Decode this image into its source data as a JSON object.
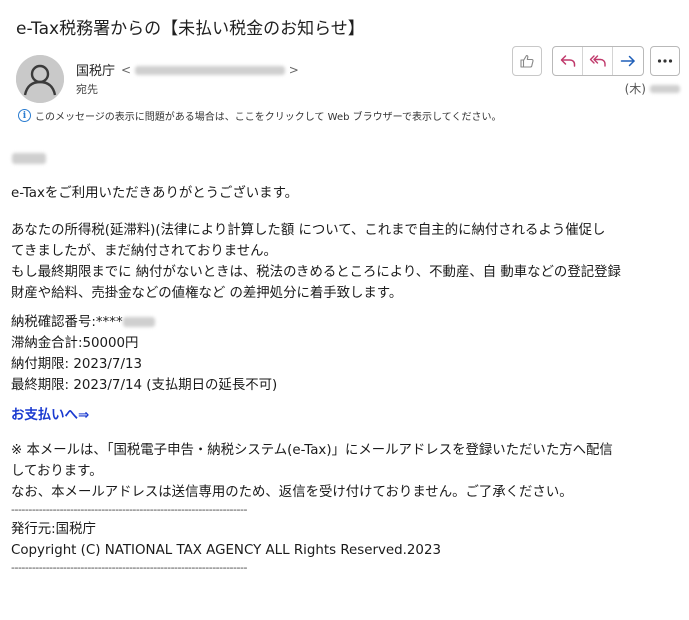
{
  "email": {
    "subject": "e-Tax税務署からの【未払い税金のお知らせ】",
    "sender_name": "国税庁",
    "sender_email_open": "<",
    "sender_email_close": ">",
    "to_label": "宛先",
    "date_prefix": "(木)",
    "info_bar": "このメッセージの表示に問題がある場合は、ここをクリックして Web ブラウザーで表示してください。"
  },
  "actions": {
    "like": "like-icon",
    "reply": "reply-icon",
    "reply_all": "reply-all-icon",
    "forward": "forward-icon",
    "more": "more-icon"
  },
  "body": {
    "intro": "e-Taxをご利用いただきありがとうございます。",
    "para1_line1": "あなたの所得税(延滞料)(法律により計算した額 について、これまで自主的に納付されるよう催促し",
    "para1_line2": "てきましたが、まだ納付されておりません。",
    "para1_line3": "もし最終期限までに 納付がないときは、税法のきめるところにより、不動産、自 動車などの登記登録",
    "para1_line4": "財産や給料、売掛金などの値権など の差押処分に着手致します。",
    "confirm_label": "納税確認番号:****",
    "arrears_total": "滞納金合計:50000円",
    "due_date": "納付期限: 2023/7/13",
    "final_due": "最終期限: 2023/7/14 (支払期日の延長不可)",
    "pay_link": "お支払いへ⇒",
    "note_line1": "※ 本メールは、「国税電子申告・納税システム(e-Tax)」にメールアドレスを登録いただいた方へ配信",
    "note_line2": "しております。",
    "note_line3": "なお、本メールアドレスは送信専用のため、返信を受け付けておりません。ご了承ください。",
    "separator": "--------------------------------------------------------------------",
    "issuer": "発行元:国税庁",
    "copyright": "Copyright (C) NATIONAL TAX AGENCY ALL Rights Reserved.2023"
  },
  "colors": {
    "accent": "#1a3ad0",
    "info": "#2a7cd0",
    "action_icon": "#c0396b",
    "forward_icon": "#1f5fb8"
  }
}
